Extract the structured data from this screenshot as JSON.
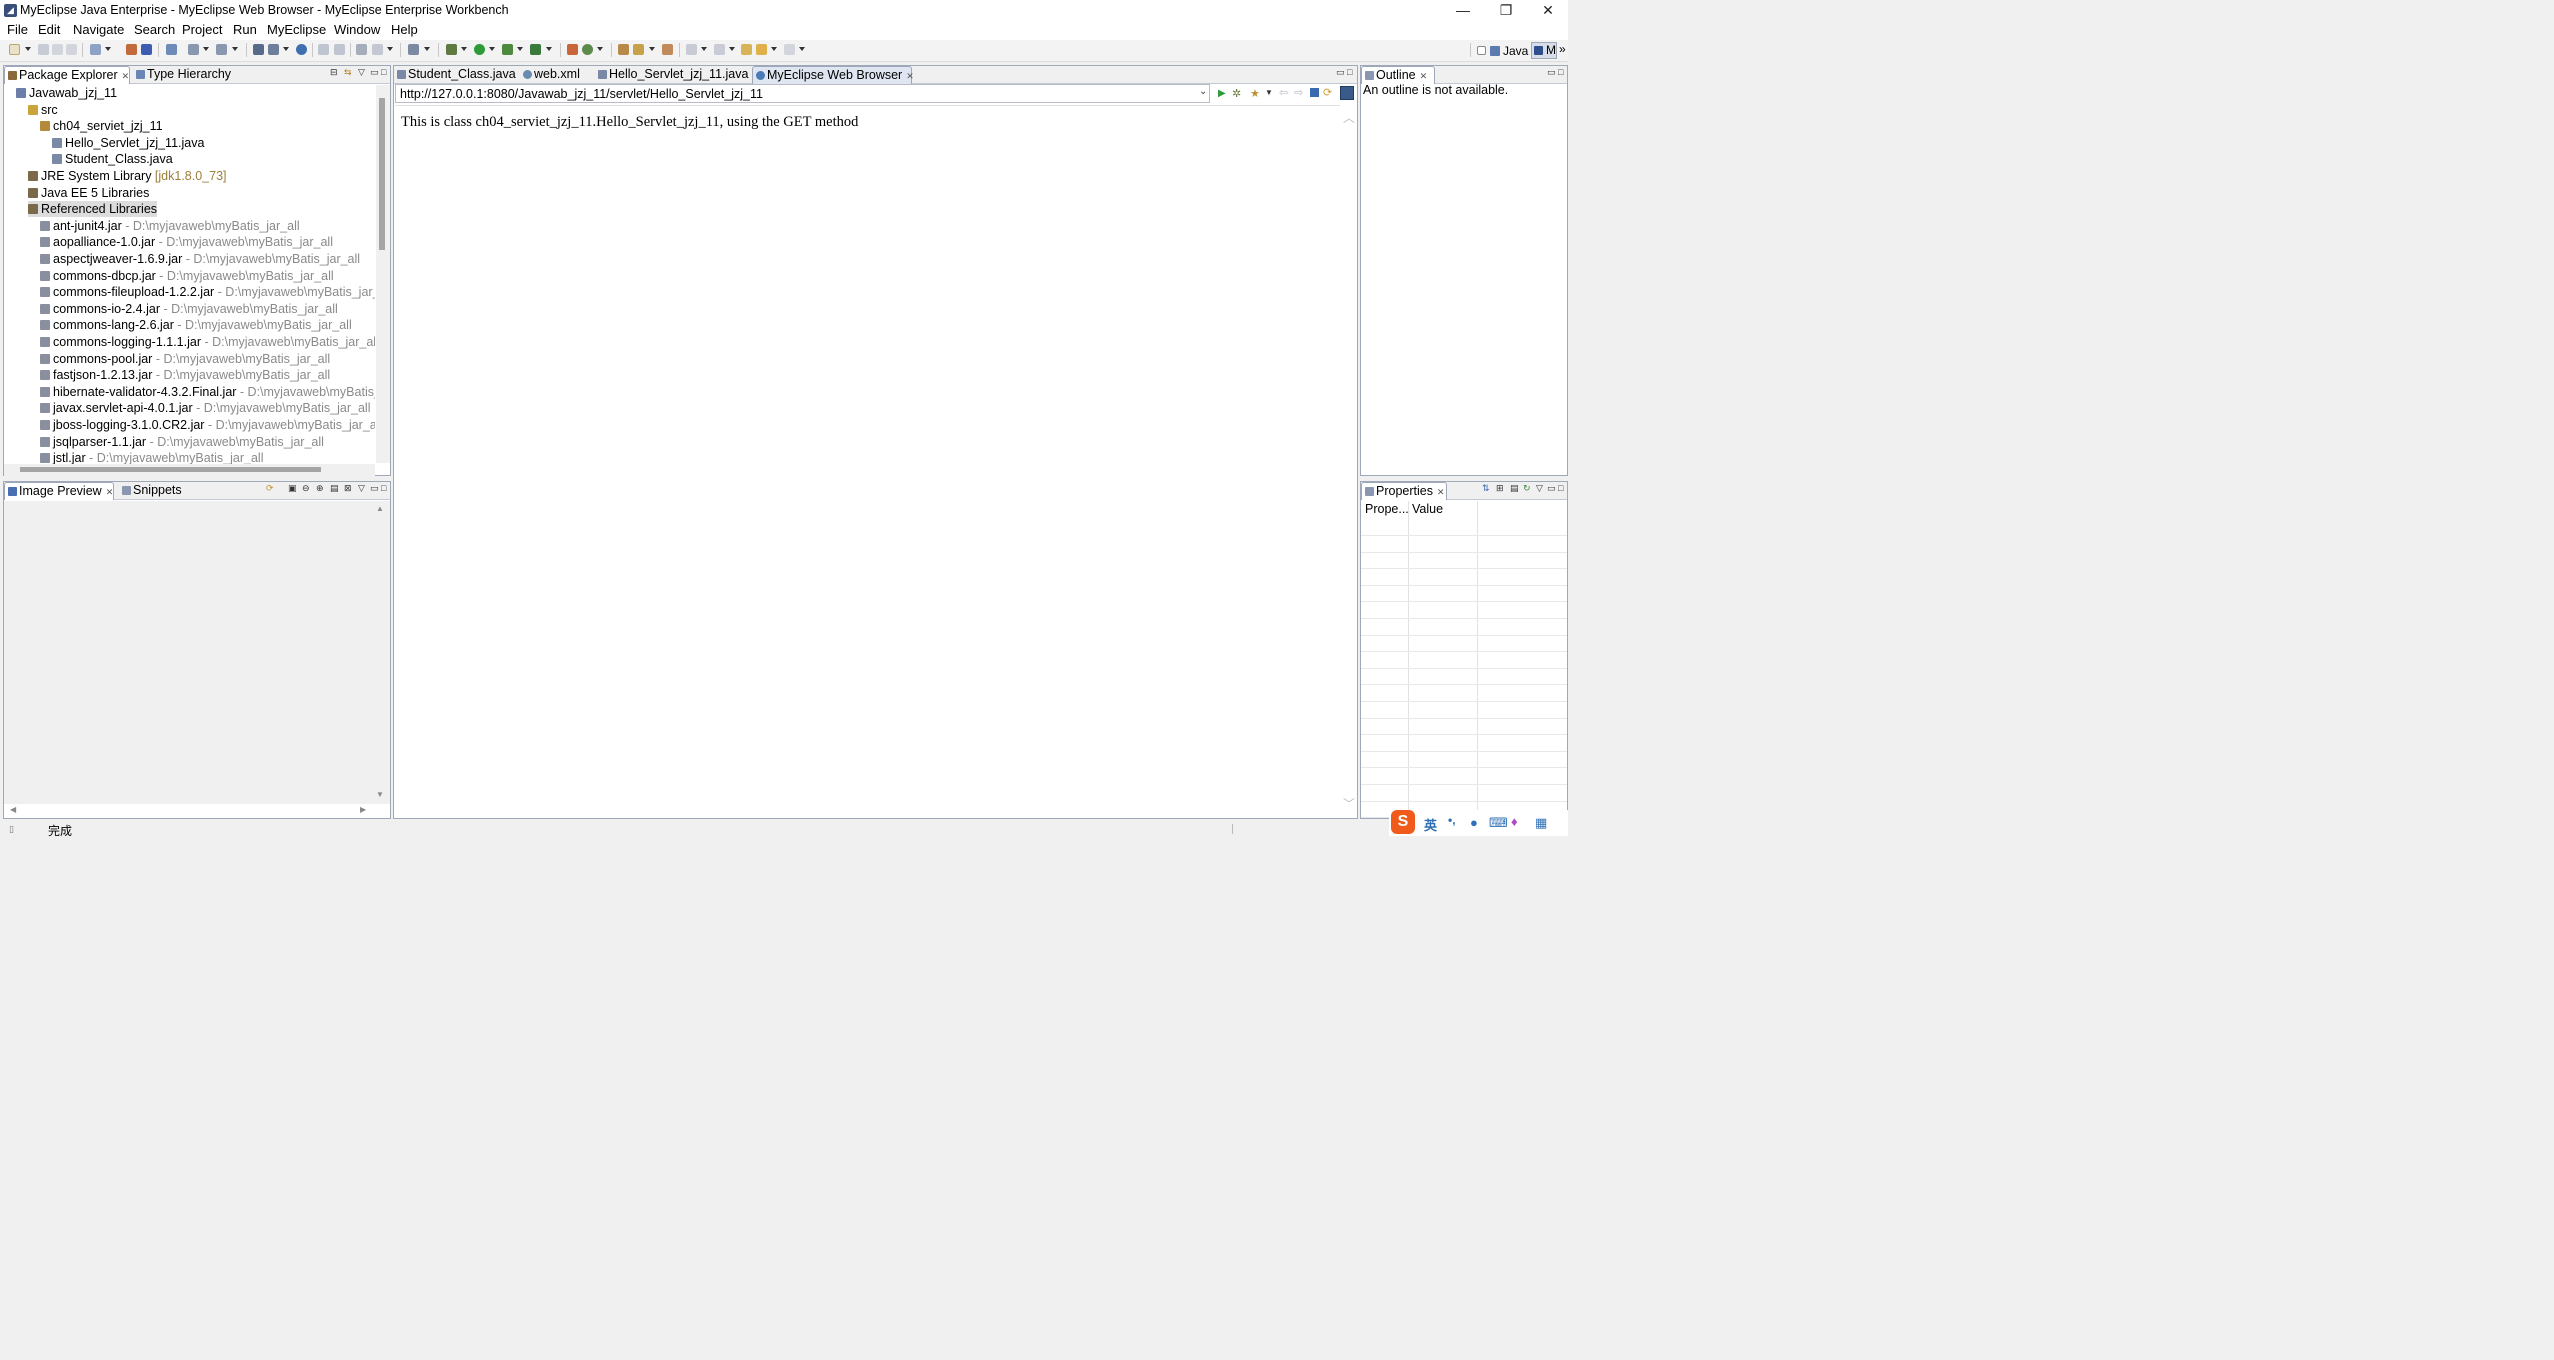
{
  "window": {
    "title": "MyEclipse Java Enterprise - MyEclipse Web Browser - MyEclipse Enterprise Workbench",
    "minimize_glyph": "—",
    "maximize_glyph": "❐",
    "close_glyph": "✕"
  },
  "menu": [
    {
      "label": "File",
      "mnemonic": "F"
    },
    {
      "label": "Edit",
      "mnemonic": "E"
    },
    {
      "label": "Navigate",
      "mnemonic": "N"
    },
    {
      "label": "Search",
      "mnemonic": "a"
    },
    {
      "label": "Project",
      "mnemonic": "P"
    },
    {
      "label": "Run",
      "mnemonic": "R"
    },
    {
      "label": "MyEclipse",
      "mnemonic": ""
    },
    {
      "label": "Window",
      "mnemonic": "W"
    },
    {
      "label": "Help",
      "mnemonic": "H"
    }
  ],
  "perspectives": {
    "java": "Java",
    "m": "M",
    "more": "»"
  },
  "package_explorer": {
    "tabs": [
      "Package Explorer",
      "Type Hierarchy"
    ],
    "rows": [
      {
        "label": "Javawab_jzj_11",
        "suffix": "",
        "indent": 0,
        "icon": "project-icon",
        "color": "#6b7fa8"
      },
      {
        "label": "src",
        "suffix": "",
        "indent": 1,
        "icon": "source-folder-icon",
        "color": "#c9a43a"
      },
      {
        "label": "ch04_serviet_jzj_11",
        "suffix": "",
        "indent": 2,
        "icon": "package-icon",
        "color": "#b48a3a"
      },
      {
        "label": "Hello_Servlet_jzj_11.java",
        "suffix": "",
        "indent": 3,
        "icon": "java-file-icon",
        "color": "#7a8aa6"
      },
      {
        "label": "Student_Class.java",
        "suffix": "",
        "indent": 3,
        "icon": "java-file-icon",
        "color": "#7a8aa6"
      },
      {
        "label": "JRE System Library",
        "suffix": " [jdk1.8.0_73]",
        "indent": 1,
        "icon": "library-icon",
        "color": "#7a6a4a",
        "suffix_class": "jre"
      },
      {
        "label": "Java EE 5 Libraries",
        "suffix": "",
        "indent": 1,
        "icon": "library-icon",
        "color": "#7a6a4a"
      },
      {
        "label": "Referenced Libraries",
        "suffix": "",
        "indent": 1,
        "icon": "library-icon",
        "color": "#7a6a4a",
        "selected": true
      },
      {
        "label": "ant-junit4.jar",
        "suffix": " - D:\\myjavaweb\\myBatis_jar_all",
        "indent": 2,
        "icon": "jar-icon",
        "color": "#8a8fa0"
      },
      {
        "label": "aopalliance-1.0.jar",
        "suffix": " - D:\\myjavaweb\\myBatis_jar_all",
        "indent": 2,
        "icon": "jar-icon",
        "color": "#8a8fa0"
      },
      {
        "label": "aspectjweaver-1.6.9.jar",
        "suffix": " - D:\\myjavaweb\\myBatis_jar_all",
        "indent": 2,
        "icon": "jar-icon",
        "color": "#8a8fa0"
      },
      {
        "label": "commons-dbcp.jar",
        "suffix": " - D:\\myjavaweb\\myBatis_jar_all",
        "indent": 2,
        "icon": "jar-icon",
        "color": "#8a8fa0"
      },
      {
        "label": "commons-fileupload-1.2.2.jar",
        "suffix": " - D:\\myjavaweb\\myBatis_jar_all",
        "indent": 2,
        "icon": "jar-icon",
        "color": "#8a8fa0"
      },
      {
        "label": "commons-io-2.4.jar",
        "suffix": " - D:\\myjavaweb\\myBatis_jar_all",
        "indent": 2,
        "icon": "jar-icon",
        "color": "#8a8fa0"
      },
      {
        "label": "commons-lang-2.6.jar",
        "suffix": " - D:\\myjavaweb\\myBatis_jar_all",
        "indent": 2,
        "icon": "jar-icon",
        "color": "#8a8fa0"
      },
      {
        "label": "commons-logging-1.1.1.jar",
        "suffix": " - D:\\myjavaweb\\myBatis_jar_all",
        "indent": 2,
        "icon": "jar-icon",
        "color": "#8a8fa0"
      },
      {
        "label": "commons-pool.jar",
        "suffix": " - D:\\myjavaweb\\myBatis_jar_all",
        "indent": 2,
        "icon": "jar-icon",
        "color": "#8a8fa0"
      },
      {
        "label": "fastjson-1.2.13.jar",
        "suffix": " - D:\\myjavaweb\\myBatis_jar_all",
        "indent": 2,
        "icon": "jar-icon",
        "color": "#8a8fa0"
      },
      {
        "label": "hibernate-validator-4.3.2.Final.jar",
        "suffix": " - D:\\myjavaweb\\myBatis_ja",
        "indent": 2,
        "icon": "jar-icon",
        "color": "#8a8fa0"
      },
      {
        "label": "javax.servlet-api-4.0.1.jar",
        "suffix": " - D:\\myjavaweb\\myBatis_jar_all",
        "indent": 2,
        "icon": "jar-icon",
        "color": "#8a8fa0"
      },
      {
        "label": "jboss-logging-3.1.0.CR2.jar",
        "suffix": " - D:\\myjavaweb\\myBatis_jar_all",
        "indent": 2,
        "icon": "jar-icon",
        "color": "#8a8fa0"
      },
      {
        "label": "jsqlparser-1.1.jar",
        "suffix": " - D:\\myjavaweb\\myBatis_jar_all",
        "indent": 2,
        "icon": "jar-icon",
        "color": "#8a8fa0"
      },
      {
        "label": "jstl.jar",
        "suffix": " - D:\\myjavaweb\\myBatis_jar_all",
        "indent": 2,
        "icon": "jar-icon",
        "color": "#8a8fa0"
      }
    ]
  },
  "image_preview": {
    "tabs": [
      "Image Preview",
      "Snippets"
    ]
  },
  "editor": {
    "tabs": [
      "Student_Class.java",
      "web.xml",
      "Hello_Servlet_jzj_11.java",
      "MyEclipse Web Browser"
    ],
    "url": "http://127.0.0.1:8080/Javawab_jzj_11/servlet/Hello_Servlet_jzj_11",
    "content": "This is class ch04_serviet_jzj_11.Hello_Servlet_jzj_11, using the GET method"
  },
  "outline": {
    "tab": "Outline",
    "message": "An outline is not available."
  },
  "properties": {
    "tab": "Properties",
    "columns": [
      "Prope...",
      "Value"
    ]
  },
  "status": {
    "text": "完成"
  },
  "ime": {
    "logo": "S",
    "lang": "英",
    "punct": "•,"
  },
  "colors": {
    "accent": "#2f6fb5",
    "panel_border": "#9fa8b8",
    "ime_orange": "#f05a1a"
  }
}
